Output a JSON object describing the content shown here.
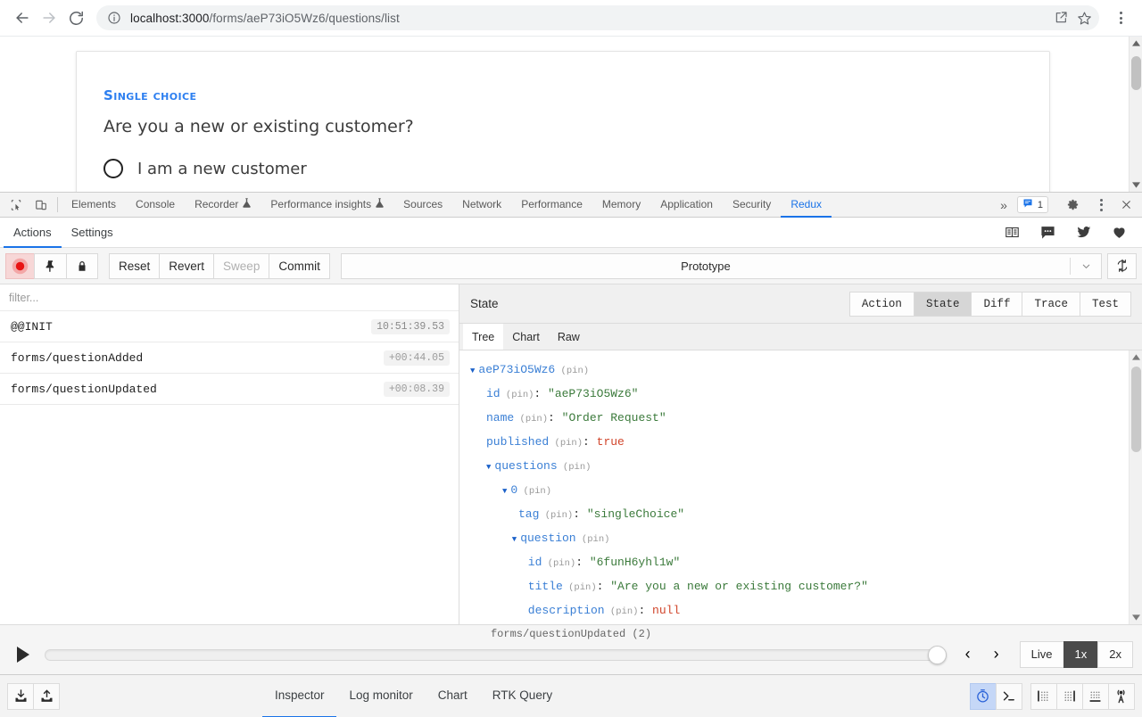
{
  "browser": {
    "back_label": "Back",
    "forward_label": "Forward",
    "reload_label": "Reload",
    "site_info_label": "View site information",
    "url_host": "localhost:3000",
    "url_path": "/forms/aeP73iO5Wz6/questions/list",
    "share_label": "Share this page",
    "bookmark_label": "Bookmark this tab",
    "menu_label": "Customize and control Google Chrome"
  },
  "page": {
    "question_kind": "Single choice",
    "question_title": "Are you a new or existing customer?",
    "option_1": "I am a new customer"
  },
  "devtools": {
    "inspect_label": "Inspect element",
    "device_label": "Toggle device toolbar",
    "tabs": [
      {
        "label": "Elements",
        "icon": "",
        "active": false
      },
      {
        "label": "Console",
        "icon": "",
        "active": false
      },
      {
        "label": "Recorder",
        "icon": "flask-icon",
        "active": false
      },
      {
        "label": "Performance insights",
        "icon": "flask-icon",
        "active": false
      },
      {
        "label": "Sources",
        "icon": "",
        "active": false
      },
      {
        "label": "Network",
        "icon": "",
        "active": false
      },
      {
        "label": "Performance",
        "icon": "",
        "active": false
      },
      {
        "label": "Memory",
        "icon": "",
        "active": false
      },
      {
        "label": "Application",
        "icon": "",
        "active": false
      },
      {
        "label": "Security",
        "icon": "",
        "active": false
      },
      {
        "label": "Redux",
        "icon": "",
        "active": true
      }
    ],
    "more_tabs_label": "»",
    "message_count": "1",
    "settings_label": "Settings",
    "menu_label": "Customize and control DevTools",
    "close_label": "Close DevTools",
    "accent_color": "#1a73e8"
  },
  "redux": {
    "subtabs": [
      {
        "label": "Actions",
        "active": true
      },
      {
        "label": "Settings",
        "active": false
      }
    ],
    "social": [
      {
        "name": "docs-icon",
        "label": "Documentation"
      },
      {
        "name": "chat-icon",
        "label": "Chat"
      },
      {
        "name": "twitter-icon",
        "label": "Twitter"
      },
      {
        "name": "heart-icon",
        "label": "Support us"
      }
    ],
    "controls": {
      "record_label": "Record",
      "pin_label": "Pin",
      "lock_label": "Lock changes",
      "reset": "Reset",
      "revert": "Revert",
      "sweep": "Sweep",
      "commit": "Commit",
      "dispatcher": "Prototype",
      "refresh_label": "Refresh"
    },
    "filter_placeholder": "filter...",
    "filter_value": "",
    "actions": [
      {
        "name": "@@INIT",
        "time": "10:51:39.53"
      },
      {
        "name": "forms/questionAdded",
        "time": "+00:44.05"
      },
      {
        "name": "forms/questionUpdated",
        "time": "+00:08.39"
      }
    ],
    "inspector": {
      "title": "State",
      "views": [
        {
          "label": "Action",
          "active": false
        },
        {
          "label": "State",
          "active": true
        },
        {
          "label": "Diff",
          "active": false
        },
        {
          "label": "Trace",
          "active": false
        },
        {
          "label": "Test",
          "active": false
        }
      ],
      "subviews": [
        {
          "label": "Tree",
          "active": true
        },
        {
          "label": "Chart",
          "active": false
        },
        {
          "label": "Raw",
          "active": false
        }
      ],
      "pin_label": "(pin)",
      "tree": [
        {
          "indent": 0,
          "arrow": "▼",
          "key": "aeP73iO5Wz6",
          "value": "",
          "vtype": "none"
        },
        {
          "indent": 1,
          "arrow": "",
          "key": "id",
          "value": "\"aeP73iO5Wz6\"",
          "vtype": "string"
        },
        {
          "indent": 1,
          "arrow": "",
          "key": "name",
          "value": "\"Order Request\"",
          "vtype": "string"
        },
        {
          "indent": 1,
          "arrow": "",
          "key": "published",
          "value": "true",
          "vtype": "bool"
        },
        {
          "indent": 1,
          "arrow": "▼",
          "key": "questions",
          "value": "",
          "vtype": "none"
        },
        {
          "indent": 2,
          "arrow": "▼",
          "key": "0",
          "value": "",
          "vtype": "none"
        },
        {
          "indent": 3,
          "arrow": "",
          "key": "tag",
          "value": "\"singleChoice\"",
          "vtype": "string"
        },
        {
          "indent": 2.6,
          "arrow": "▼",
          "key": "question",
          "value": "",
          "vtype": "none"
        },
        {
          "indent": 3.6,
          "arrow": "",
          "key": "id",
          "value": "\"6funH6yhl1w\"",
          "vtype": "string"
        },
        {
          "indent": 3.6,
          "arrow": "",
          "key": "title",
          "value": "\"Are you a new or existing customer?\"",
          "vtype": "string"
        },
        {
          "indent": 3.6,
          "arrow": "",
          "key": "description",
          "value": "null",
          "vtype": "bool"
        }
      ]
    },
    "slider": {
      "caption": "forms/questionUpdated  (2)",
      "play_label": "Play",
      "prev_label": "‹",
      "next_label": "›",
      "speeds": [
        {
          "label": "Live",
          "active": false
        },
        {
          "label": "1x",
          "active": true
        },
        {
          "label": "2x",
          "active": false
        }
      ]
    }
  },
  "statusbar": {
    "import_label": "Import",
    "export_label": "Export",
    "monitors": [
      {
        "label": "Inspector",
        "active": true
      },
      {
        "label": "Log monitor",
        "active": false
      },
      {
        "label": "Chart",
        "active": false
      },
      {
        "label": "RTK Query",
        "active": false
      }
    ],
    "right_icons": [
      {
        "name": "stopwatch-icon",
        "label": "Performance monitor",
        "accent": true
      },
      {
        "name": "terminal-icon",
        "label": "Console",
        "accent": false
      },
      {
        "name": "dock-left-icon",
        "label": "Dock to left",
        "accent": false
      },
      {
        "name": "dock-right-icon",
        "label": "Dock to right",
        "accent": false
      },
      {
        "name": "dock-bottom-icon",
        "label": "Dock to bottom",
        "accent": false
      },
      {
        "name": "broadcast-icon",
        "label": "Remote devtools",
        "accent": false
      }
    ]
  }
}
